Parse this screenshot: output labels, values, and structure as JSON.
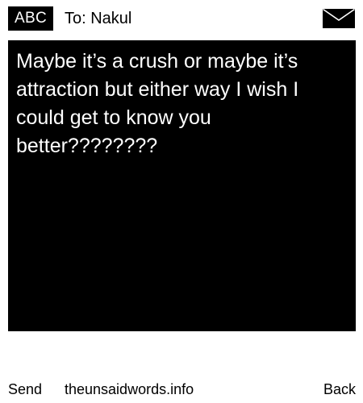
{
  "header": {
    "mode_label": "ABC",
    "recipient_label": "To: Nakul",
    "icon": "envelope-icon"
  },
  "message": {
    "text": "Maybe it’s a crush or maybe it’s attraction but either way I wish I could get to know you better????????"
  },
  "footer": {
    "send_label": "Send",
    "site_label": "theunsaidwords.info",
    "back_label": "Back"
  },
  "colors": {
    "background": "#ffffff",
    "message_bg": "#000000",
    "message_text": "#ffffff",
    "text": "#000000"
  }
}
